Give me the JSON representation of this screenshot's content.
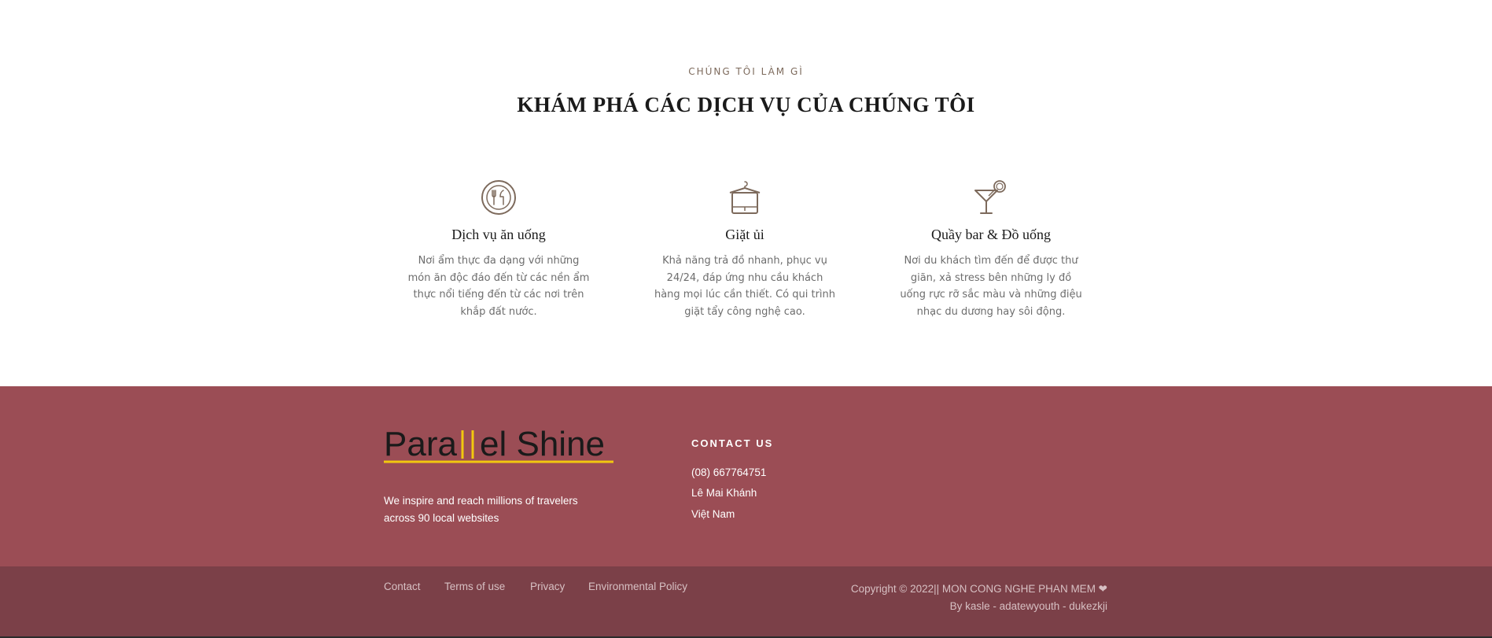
{
  "services": {
    "eyebrow": "CHÚNG TÔI LÀM GÌ",
    "heading": "KHÁM PHÁ CÁC DỊCH VỤ CỦA CHÚNG TÔI",
    "items": [
      {
        "icon": "plate-utensils-icon",
        "title": "Dịch vụ ăn uống",
        "description": "Nơi ẩm thực đa dạng với những món ăn độc đáo đến từ các nền ẩm thực nổi tiếng đến từ các nơi trên khắp đất nước."
      },
      {
        "icon": "laundry-hanger-icon",
        "title": "Giặt ủi",
        "description": "Khả năng trả đồ nhanh, phục vụ 24/24, đáp ứng nhu cầu khách hàng mọi lúc cần thiết. Có qui trình giặt tẩy công nghệ cao."
      },
      {
        "icon": "cocktail-glass-icon",
        "title": "Quầy bar & Đồ uống",
        "description": "Nơi du khách tìm đến để được thư giãn, xả stress bên những ly đồ uống rực rỡ sắc màu và những điệu nhạc du dương hay sôi động."
      }
    ]
  },
  "footer": {
    "logo_text": "Parallel Shine",
    "tagline": "We inspire and reach millions of travelers across 90 local websites",
    "contact_title": "CONTACT US",
    "phone": "(08) 667764751",
    "address": "Lê Mai Khánh",
    "country": "Việt Nam",
    "links": [
      "Contact",
      "Terms of use",
      "Privacy",
      "Environmental Policy"
    ],
    "copyright": "Copyright © 2022|| MON CONG NGHE PHAN MEM ❤",
    "credits": "By kasle - adatewyouth - dukezkji"
  },
  "colors": {
    "footer_top": "#9b4d55",
    "footer_bottom": "#7b4048",
    "logo_accent": "#f2c80f",
    "icon_stroke": "#7d6a5c"
  }
}
